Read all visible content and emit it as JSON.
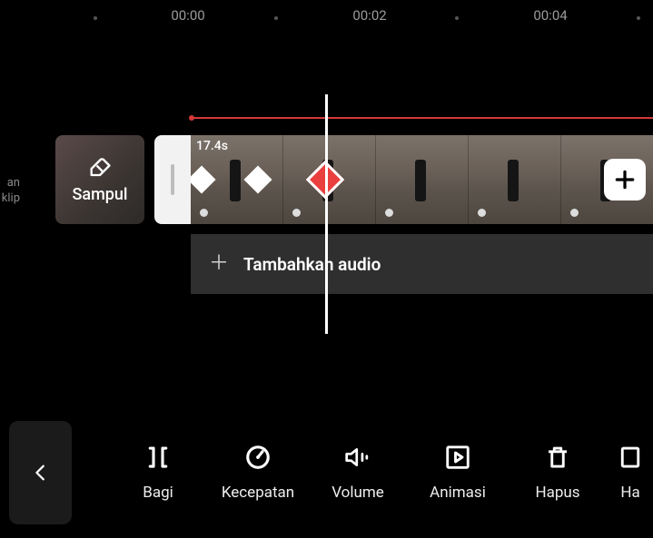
{
  "ruler": {
    "labels": [
      "00:00",
      "00:02",
      "00:04"
    ]
  },
  "side_partial": {
    "line1": "an",
    "line2": "klip"
  },
  "cover": {
    "label": "Sampul"
  },
  "clip": {
    "duration_label": "17.4s"
  },
  "audio": {
    "add_label": "Tambahkan audio"
  },
  "toolbar": {
    "split": "Bagi",
    "speed": "Kecepatan",
    "volume": "Volume",
    "anim": "Animasi",
    "delete": "Hapus",
    "next_partial": "Ha"
  }
}
